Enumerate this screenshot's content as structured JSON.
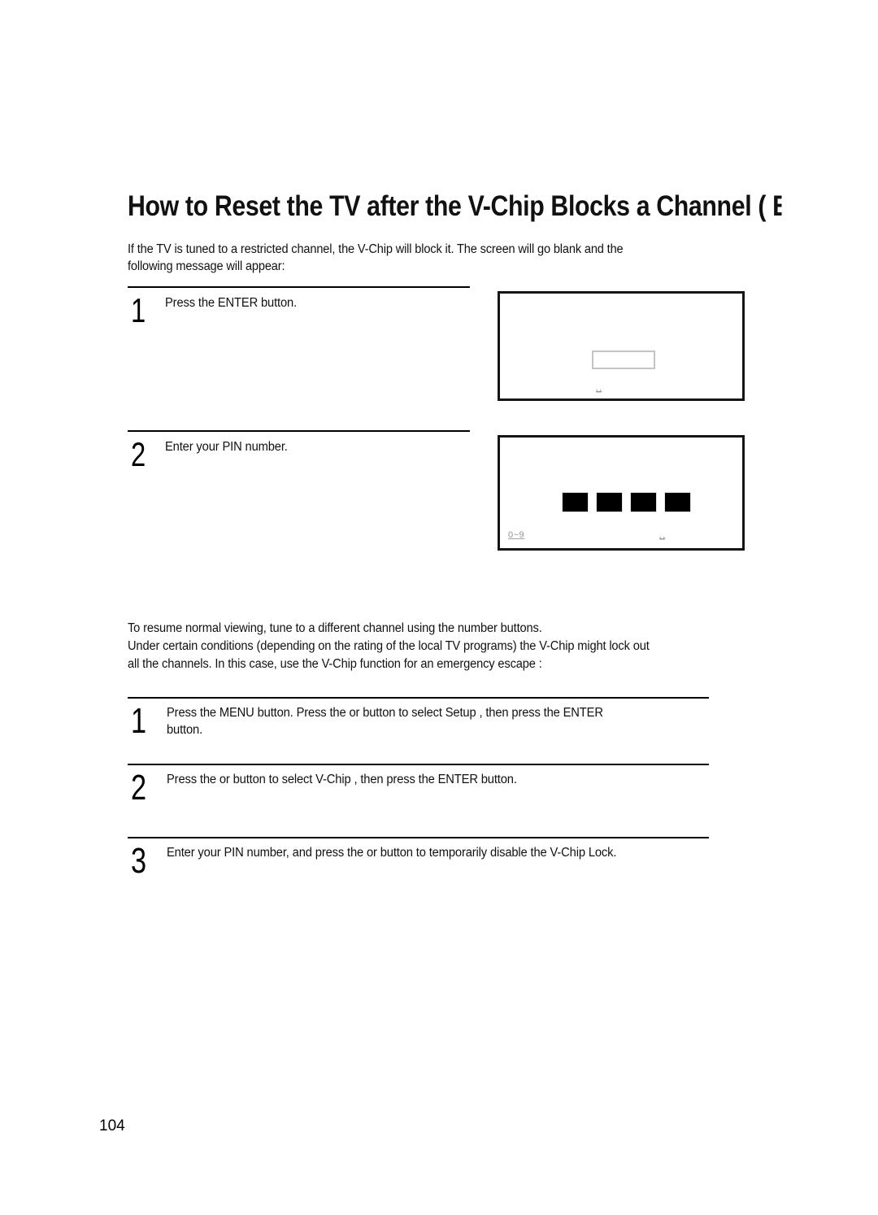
{
  "document": {
    "title": "How to Reset the TV after the V-Chip Blocks a Channel ( Emerger",
    "page_number": "104"
  },
  "intro": {
    "line1": "If the TV is tuned to a restricted channel, the V-Chip will block it. The screen will go blank and the",
    "line2": "following message will appear:"
  },
  "upper_steps": [
    {
      "number": "1",
      "line1": "Press the ENTER button."
    },
    {
      "number": "2",
      "line1": "Enter your PIN number."
    }
  ],
  "illustrations": {
    "screen1": {
      "glyph_center": "␣"
    },
    "screen2": {
      "pin_cells": [
        "",
        "",
        "",
        ""
      ],
      "glyph_left": "0~9",
      "glyph_right": "␣"
    }
  },
  "mid_paragraph": {
    "line1": "To resume normal viewing, tune to a different channel using the number buttons.",
    "line2": "Under certain conditions (depending on the rating of the local TV programs) the V-Chip might lock out",
    "line3": "all the channels. In this case, use the V-Chip function for an  emergency escape :"
  },
  "lower_steps": [
    {
      "number": "1",
      "line1": "Press the MENU button. Press the  or     button to select  Setup , then press the ENTER",
      "line2": "button."
    },
    {
      "number": "2",
      "line1": "Press the   or     button to select  V-Chip , then press the ENTER button."
    },
    {
      "number": "3",
      "line1": "Enter your PIN number, and press the   or     button to temporarily disable the V-Chip Lock."
    }
  ],
  "colors": {
    "text": "#111111",
    "rule": "#000000",
    "box_border": "#151515",
    "pin_fill": "#000000",
    "pin_empty_border": "#c4c4c4",
    "glyph": "#8a8a8a"
  }
}
